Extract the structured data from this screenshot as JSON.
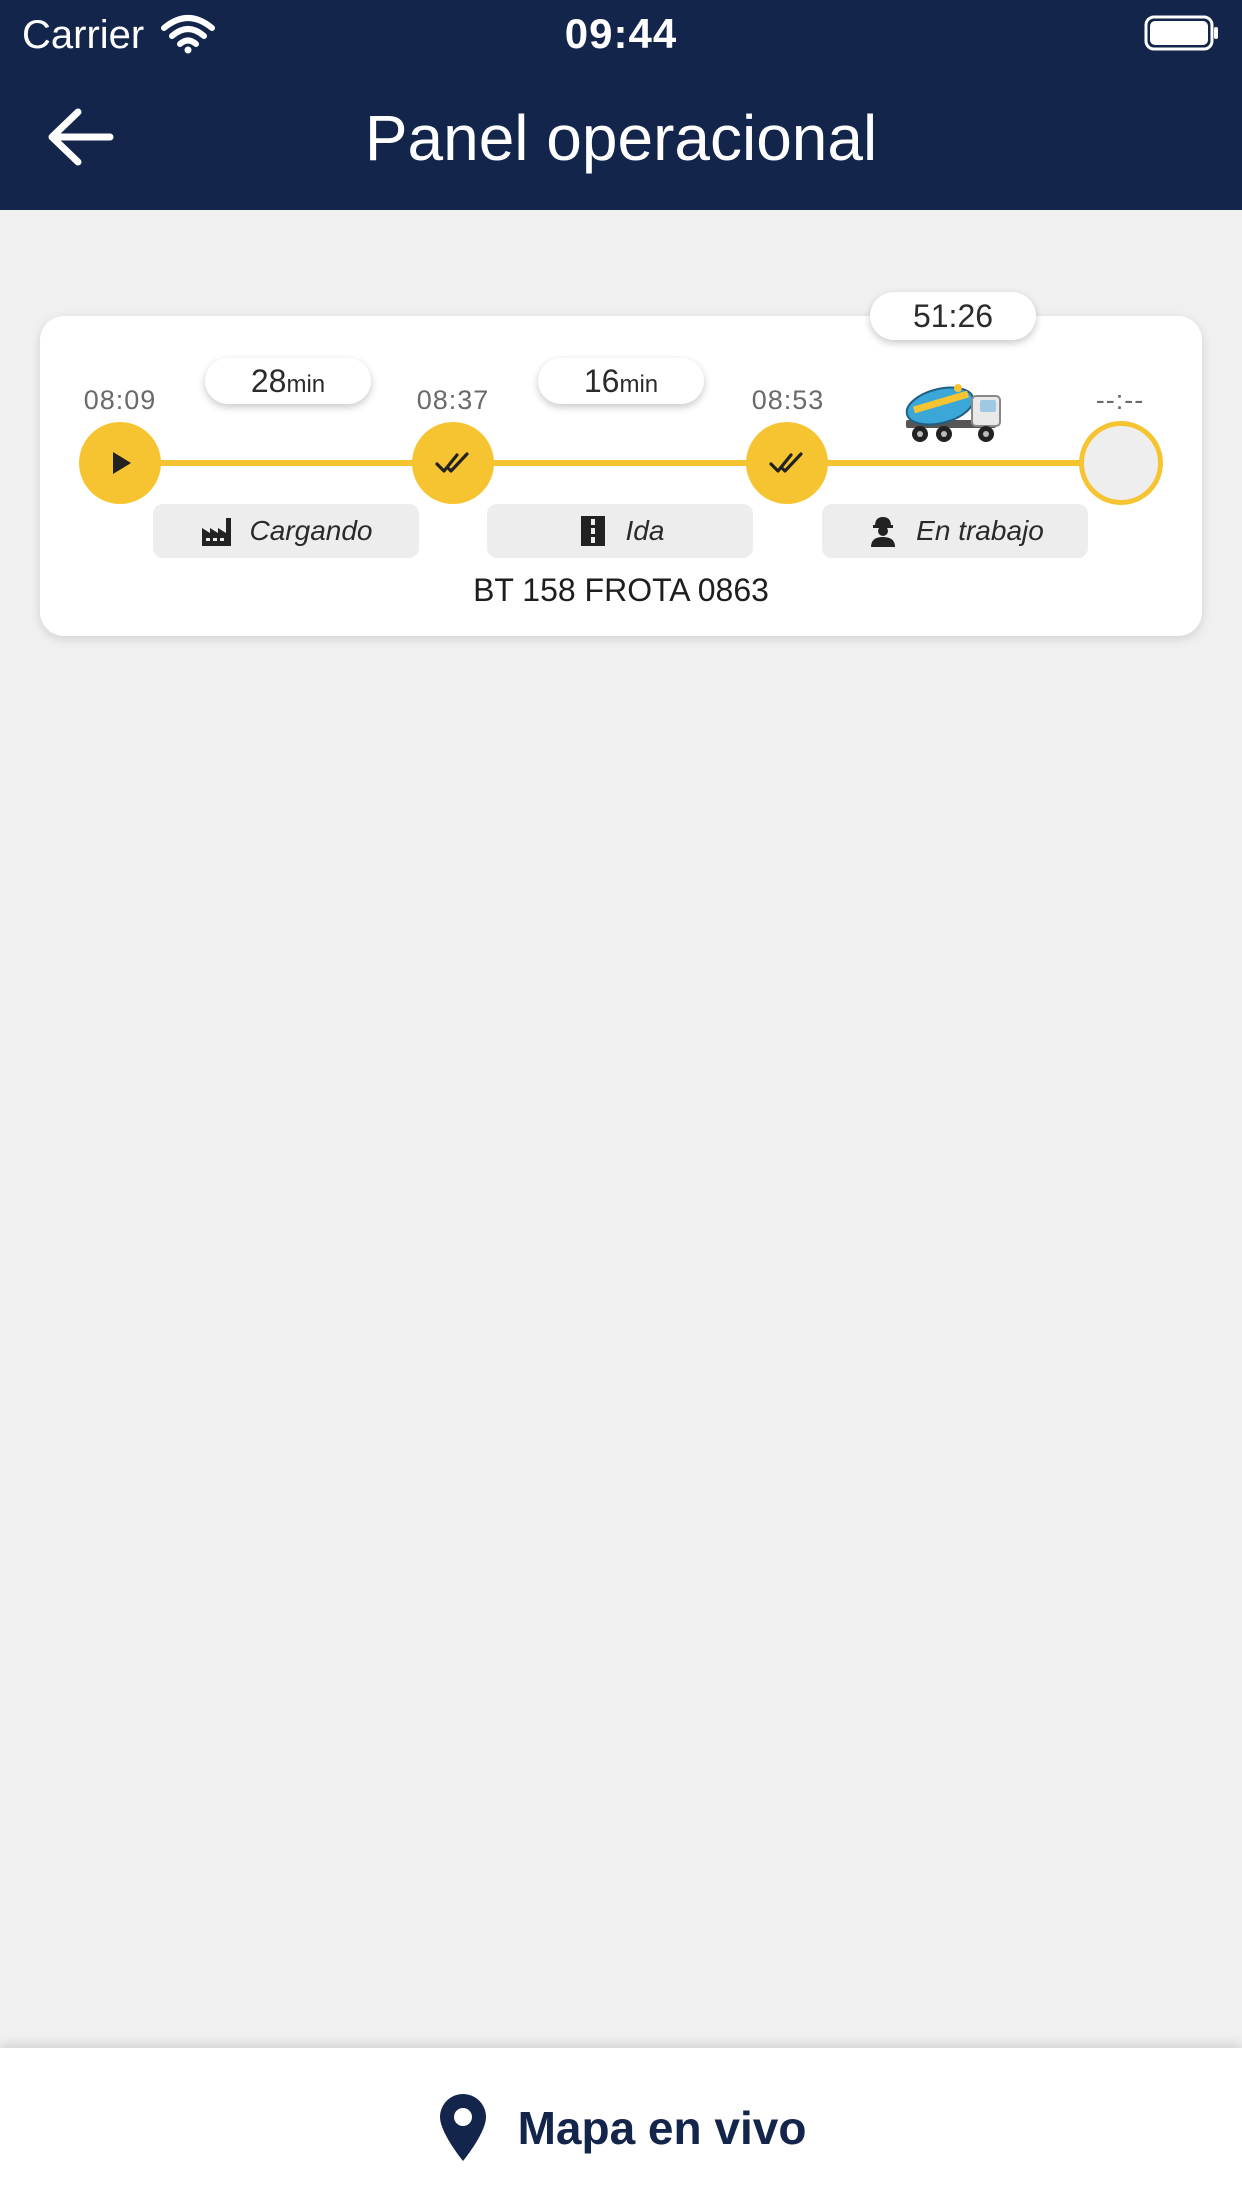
{
  "status_bar": {
    "carrier": "Carrier",
    "time": "09:44"
  },
  "header": {
    "title": "Panel operacional"
  },
  "timeline": {
    "elapsed": "51:26",
    "vehicle": "BT 158 FROTA 0863",
    "accent_color": "#f7c431",
    "checkpoints": [
      {
        "time": "08:09",
        "icon": "play-icon"
      },
      {
        "time": "08:37",
        "icon": "double-check-icon"
      },
      {
        "time": "08:53",
        "icon": "double-check-icon"
      },
      {
        "time": "--:--",
        "icon": "empty-circle"
      }
    ],
    "durations": [
      {
        "value": "28",
        "unit": "min"
      },
      {
        "value": "16",
        "unit": "min"
      }
    ],
    "stages": [
      {
        "label": "Cargando",
        "icon": "factory-icon"
      },
      {
        "label": "Ida",
        "icon": "road-icon"
      },
      {
        "label": "En trabajo",
        "icon": "worker-icon"
      }
    ]
  },
  "bottom": {
    "label": "Mapa en vivo",
    "icon": "map-pin-icon"
  },
  "colors": {
    "navy": "#13254b",
    "background": "#f0f0f0"
  }
}
